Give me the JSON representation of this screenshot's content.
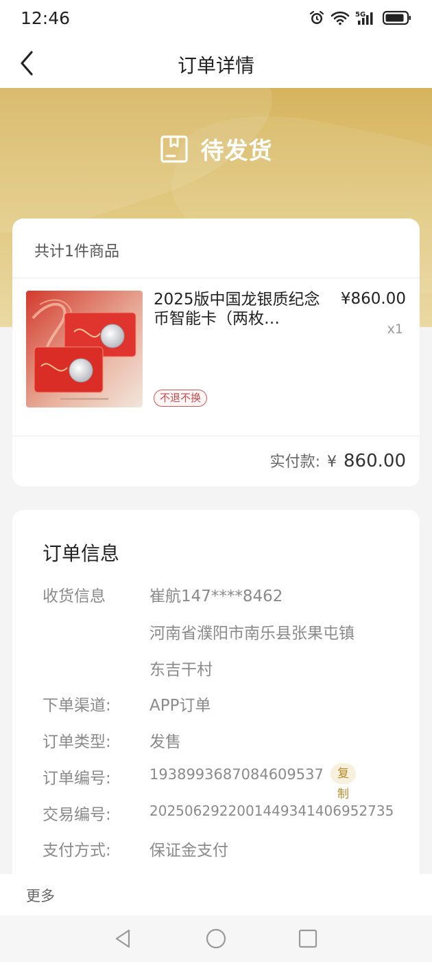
{
  "status_bar": {
    "time": "12:46",
    "icons": [
      "alarm-icon",
      "wifi-icon",
      "5g-signal-icon",
      "battery-icon"
    ],
    "network_label": "5G"
  },
  "nav": {
    "title": "订单详情",
    "back_icon": "chevron-left-icon"
  },
  "order_status": {
    "label": "待发货",
    "icon": "package-icon",
    "banner_color": "#d9b964"
  },
  "goods": {
    "header": "共计1件商品",
    "items": [
      {
        "name": "2025版中国龙银质纪念币智能卡（两枚…",
        "price": "¥860.00",
        "quantity": "x1",
        "tag": "不退不换"
      }
    ],
    "paid_label": "实付款:",
    "paid_currency": "¥",
    "paid_amount": "860.00"
  },
  "order_info": {
    "title": "订单信息",
    "receiver_label": "收货信息",
    "receiver_name_phone": "崔航147****8462",
    "address_line1": "河南省濮阳市南乐县张果屯镇",
    "address_line2": "东吉干村",
    "channel_label": "下单渠道:",
    "channel_value": "APP订单",
    "type_label": "订单类型:",
    "type_value": "发售",
    "order_no_label": "订单编号:",
    "order_no_value": "1938993687084609537",
    "copy_label": "复制",
    "trade_no_label": "交易编号:",
    "trade_no_value": "2025062922001449341406952735",
    "payment_label": "支付方式:",
    "payment_value": "保证金支付"
  },
  "more": {
    "label": "更多"
  },
  "system_nav": {
    "icons": [
      "back-triangle-icon",
      "home-circle-icon",
      "recent-square-icon"
    ]
  }
}
